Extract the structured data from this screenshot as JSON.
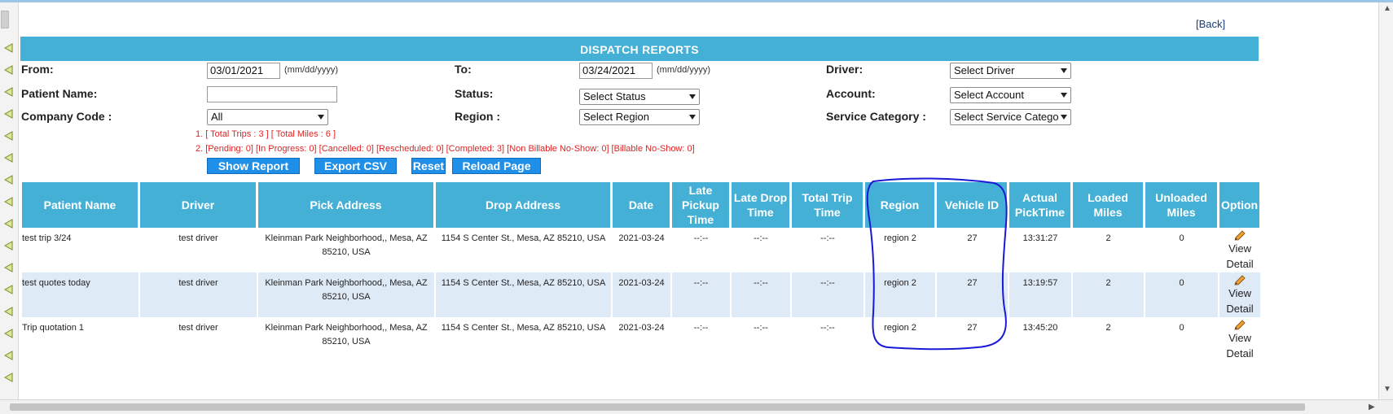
{
  "back": {
    "label": "Back"
  },
  "title": "DISPATCH REPORTS",
  "filters": {
    "from_label": "From:",
    "from_value": "03/01/2021",
    "date_hint": "(mm/dd/yyyy)",
    "to_label": "To:",
    "to_value": "03/24/2021",
    "driver_label": "Driver:",
    "driver_value": "Select Driver",
    "patient_label": "Patient Name:",
    "patient_value": "",
    "status_label": "Status:",
    "status_value": "Select Status",
    "account_label": "Account:",
    "account_value": "Select Account",
    "company_label": "Company Code :",
    "company_value": "All",
    "region_label": "Region :",
    "region_value": "Select Region",
    "service_label": "Service Category :",
    "service_value": "Select Service Catego"
  },
  "summary": {
    "line1": "1. [ Total Trips : 3 ]   [ Total Miles : 6 ]",
    "line2": "2. [Pending: 0] [In Progress: 0] [Cancelled: 0] [Rescheduled: 0] [Completed: 3] [Non Billable No-Show: 0] [Billable No-Show: 0]"
  },
  "buttons": {
    "show_report": "Show Report",
    "export_csv": "Export CSV",
    "reset": "Reset",
    "reload": "Reload Page"
  },
  "table": {
    "headers": [
      "Patient Name",
      "Driver",
      "Pick Address",
      "Drop Address",
      "Date",
      "Late Pickup Time",
      "Late Drop Time",
      "Total Trip Time",
      "Region",
      "Vehicle ID",
      "Actual PickTime",
      "Loaded Miles",
      "Unloaded Miles",
      "Option"
    ],
    "rows": [
      {
        "patient": "test trip 3/24",
        "driver": "test driver",
        "pick": "Kleinman Park Neighborhood,, Mesa, AZ 85210, USA",
        "drop": "1154 S Center St., Mesa, AZ 85210, USA",
        "date": "2021-03-24",
        "late_pickup": "--:--",
        "late_drop": "--:--",
        "total_trip": "--:--",
        "region": "region 2",
        "vehicle": "27",
        "actual_pick": "13:31:27",
        "loaded": "2",
        "unloaded": "0",
        "option": "View Detail"
      },
      {
        "patient": "test quotes today",
        "driver": "test driver",
        "pick": "Kleinman Park Neighborhood,, Mesa, AZ 85210, USA",
        "drop": "1154 S Center St., Mesa, AZ 85210, USA",
        "date": "2021-03-24",
        "late_pickup": "--:--",
        "late_drop": "--:--",
        "total_trip": "--:--",
        "region": "region 2",
        "vehicle": "27",
        "actual_pick": "13:19:57",
        "loaded": "2",
        "unloaded": "0",
        "option": "View Detail"
      },
      {
        "patient": "Trip quotation 1",
        "driver": "test driver",
        "pick": "Kleinman Park Neighborhood,, Mesa, AZ 85210, USA",
        "drop": "1154 S Center St., Mesa, AZ 85210, USA",
        "date": "2021-03-24",
        "late_pickup": "--:--",
        "late_drop": "--:--",
        "total_trip": "--:--",
        "region": "region 2",
        "vehicle": "27",
        "actual_pick": "13:45:20",
        "loaded": "2",
        "unloaded": "0",
        "option": "View Detail"
      }
    ]
  },
  "colors": {
    "header_bg": "#45b0d6",
    "button_bg": "#1f8fe8",
    "alt_row": "#dfeaf7",
    "summary_red": "#e22222",
    "annotation": "#1a1ad6"
  },
  "icons": {
    "edit": "pencil-icon",
    "rail": "triangle-left-icon"
  }
}
